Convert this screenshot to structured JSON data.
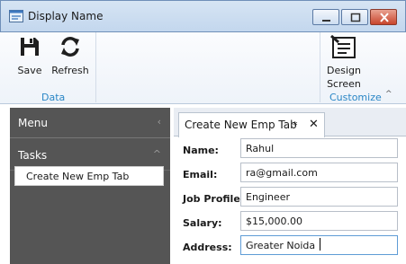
{
  "window": {
    "title": "Display Name",
    "icon": "app-window-icon",
    "controls": [
      "minimize-icon",
      "maximize-icon",
      "close-icon"
    ]
  },
  "ribbon": {
    "groups": [
      {
        "label": "Data",
        "buttons": [
          {
            "label": "Save",
            "icon": "floppy-disk-icon"
          },
          {
            "label": "Refresh",
            "icon": "refresh-icon"
          }
        ]
      },
      {
        "label": "Customize",
        "buttons": [
          {
            "label_line1": "Design",
            "label_line2": "Screen",
            "icon": "design-screen-icon"
          }
        ]
      }
    ],
    "collapse_icon": "chevron-up-icon"
  },
  "sidebar": {
    "menu_header": "Menu",
    "tasks_header": "Tasks",
    "task_items": [
      {
        "label": "Create New Emp Tab"
      }
    ]
  },
  "tab": {
    "title": "Create New Emp Tab",
    "modified_marker": "*",
    "close_glyph": "✕"
  },
  "form": {
    "fields": [
      {
        "label": "Name:",
        "value": "Rahul"
      },
      {
        "label": "Email:",
        "value": "ra@gmail.com"
      },
      {
        "label": "Job Profile:",
        "value": "Engineer"
      },
      {
        "label": "Salary:",
        "value": "$15,000.00"
      },
      {
        "label": "Address:",
        "value": "Greater Noida"
      }
    ]
  },
  "colors": {
    "accent": "#2a86c6",
    "sidebar_bg": "#555555",
    "focus_border": "#5f9cd6"
  }
}
